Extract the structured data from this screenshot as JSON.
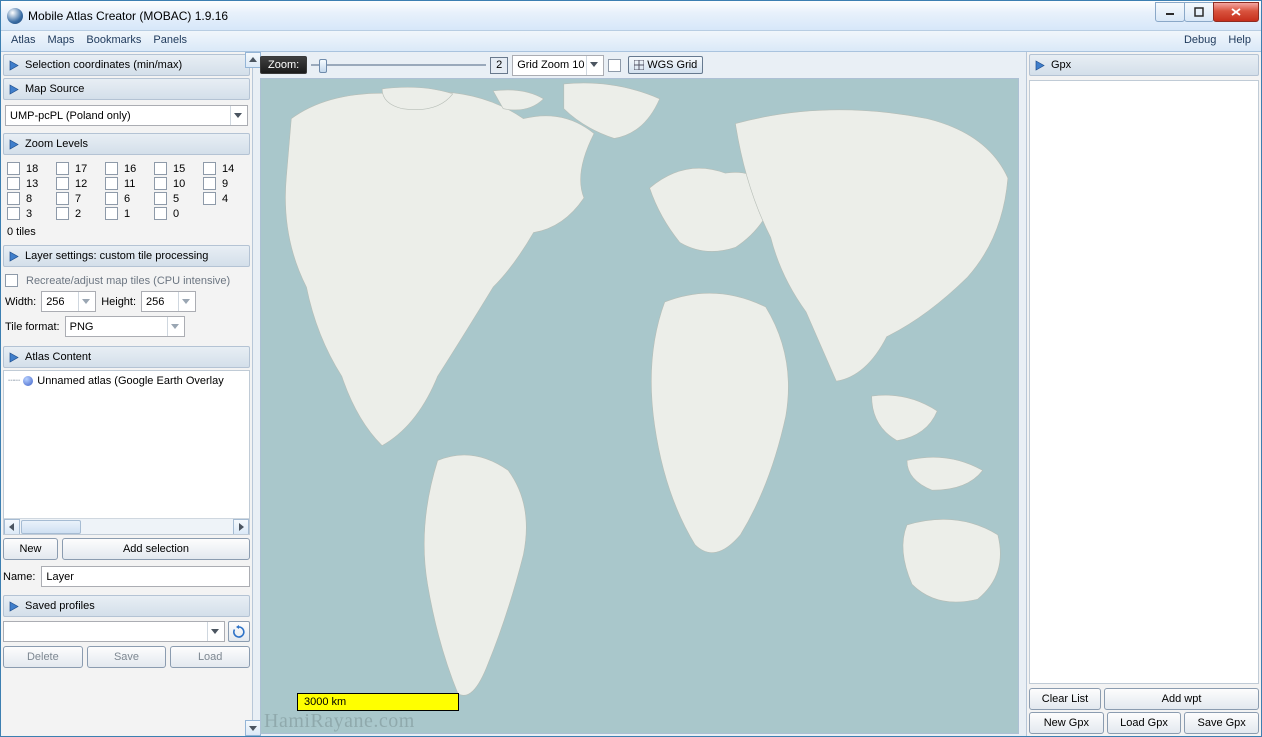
{
  "window": {
    "title": "Mobile Atlas Creator (MOBAC) 1.9.16"
  },
  "menu": {
    "left": [
      "Atlas",
      "Maps",
      "Bookmarks",
      "Panels"
    ],
    "right": [
      "Debug",
      "Help"
    ]
  },
  "left_panel": {
    "sections": {
      "selection": "Selection coordinates (min/max)",
      "mapsource": "Map Source",
      "zoomlevels": "Zoom Levels",
      "layersettings": "Layer settings: custom tile processing",
      "atlascontent": "Atlas Content",
      "savedprofiles": "Saved profiles"
    },
    "mapsource_value": "UMP-pcPL (Poland only)",
    "zoom_levels": [
      "18",
      "17",
      "16",
      "15",
      "14",
      "13",
      "12",
      "11",
      "10",
      "9",
      "8",
      "7",
      "6",
      "5",
      "4",
      "3",
      "2",
      "1",
      "0"
    ],
    "tiles_count": "0 tiles",
    "recreate_label": "Recreate/adjust map tiles (CPU intensive)",
    "width_label": "Width:",
    "width_value": "256",
    "height_label": "Height:",
    "height_value": "256",
    "tileformat_label": "Tile format:",
    "tileformat_value": "PNG",
    "atlas_tree_item": "Unnamed atlas (Google Earth Overlay",
    "new_btn": "New",
    "add_selection_btn": "Add selection",
    "name_label": "Name:",
    "name_value": "Layer",
    "delete_btn": "Delete",
    "save_btn": "Save",
    "load_btn": "Load"
  },
  "map_toolbar": {
    "zoom_label": "Zoom:",
    "zoom_value": "2",
    "gridzoom_value": "Grid Zoom 10",
    "wgs_label": "WGS Grid"
  },
  "map": {
    "scalebar": "3000 km"
  },
  "right_panel": {
    "header": "Gpx",
    "clear_btn": "Clear List",
    "addwpt_btn": "Add wpt",
    "newgpx_btn": "New Gpx",
    "loadgpx_btn": "Load Gpx",
    "savegpx_btn": "Save Gpx"
  },
  "watermark": "HamiRayane.com"
}
